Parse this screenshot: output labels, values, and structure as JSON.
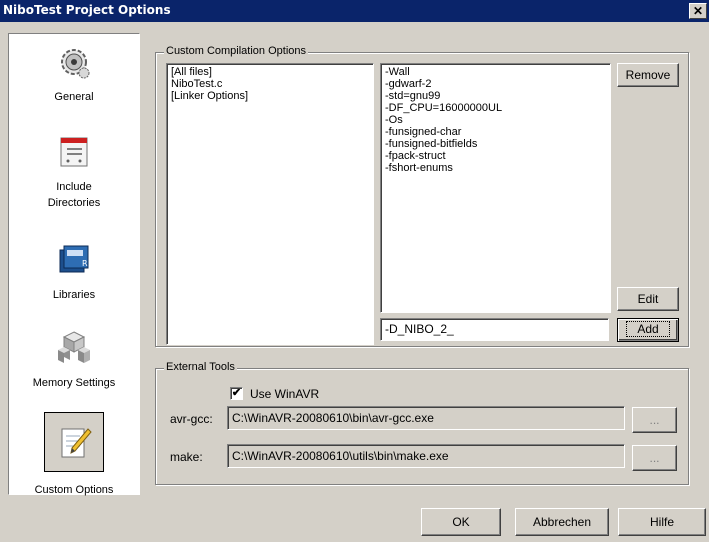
{
  "window": {
    "title": "NiboTest Project Options",
    "close_glyph": "✕"
  },
  "sidebar": {
    "items": [
      {
        "label": "General",
        "icon": "gear-icon"
      },
      {
        "label": "Include Directories",
        "icon": "include-directories-icon"
      },
      {
        "label": "Libraries",
        "icon": "books-icon"
      },
      {
        "label": "Memory Settings",
        "icon": "cubes-icon"
      },
      {
        "label": "Custom Options",
        "icon": "notepad-pencil-icon",
        "selected": true
      }
    ]
  },
  "custom_compilation": {
    "legend": "Custom Compilation Options",
    "files": [
      "[All files]",
      "NiboTest.c",
      "[Linker Options]"
    ],
    "options": [
      "-Wall",
      "-gdwarf-2",
      "-std=gnu99",
      "-DF_CPU=16000000UL",
      "-Os",
      "-funsigned-char",
      "-funsigned-bitfields",
      "-fpack-struct",
      "-fshort-enums"
    ],
    "new_option_value": "-D_NIBO_2_",
    "remove_label": "Remove",
    "edit_label": "Edit",
    "add_label": "Add"
  },
  "external_tools": {
    "legend": "External Tools",
    "use_winavr_label": "Use WinAVR",
    "use_winavr_checked": true,
    "avr_gcc_label": "avr-gcc:",
    "avr_gcc_path": "C:\\WinAVR-20080610\\bin\\avr-gcc.exe",
    "make_label": "make:",
    "make_path": "C:\\WinAVR-20080610\\utils\\bin\\make.exe",
    "browse_label": "..."
  },
  "footer": {
    "ok_label": "OK",
    "cancel_label": "Abbrechen",
    "help_label": "Hilfe"
  }
}
